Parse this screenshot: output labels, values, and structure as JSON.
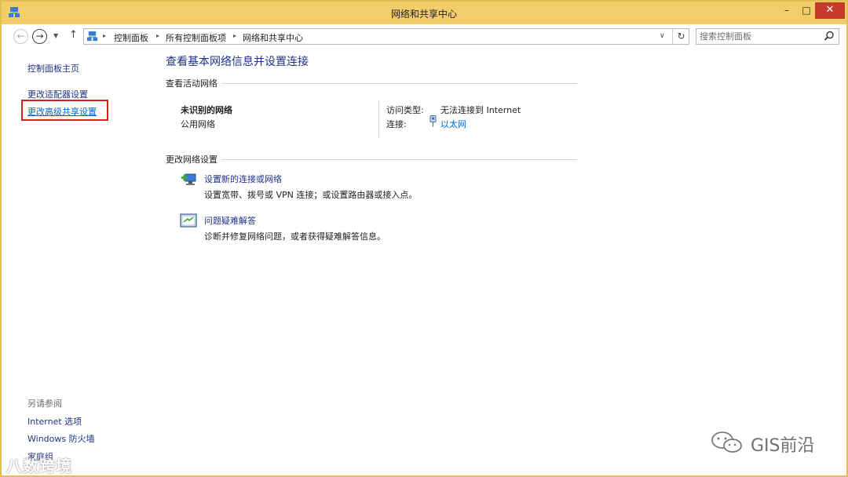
{
  "window": {
    "title": "网络和共享中心",
    "min_glyph": "–",
    "max_glyph": "□",
    "close_glyph": "✕"
  },
  "nav": {
    "back_glyph": "←",
    "forward_glyph": "→",
    "recent_glyph": "▼",
    "up_glyph": "↑"
  },
  "breadcrumb": [
    "控制面板",
    "所有控制面板项",
    "网络和共享中心"
  ],
  "address": {
    "separator_glyph": "▸",
    "dropdown_glyph": "∨",
    "refresh_glyph": "↻"
  },
  "search": {
    "placeholder": "搜索控制面板"
  },
  "sidebar": {
    "items": [
      "控制面板主页",
      "更改适配器设置",
      "更改高级共享设置"
    ],
    "see_also_title": "另请参阅",
    "see_also": [
      "Internet 选项",
      "Windows 防火墙",
      "家庭组"
    ]
  },
  "main": {
    "title": "查看基本网络信息并设置连接",
    "active_network_header": "查看活动网络",
    "network": {
      "name": "未识别的网络",
      "category": "公用网络",
      "access_label": "访问类型:",
      "access_value": "无法连接到 Internet",
      "connection_label": "连接:",
      "connection_value": "以太网"
    },
    "change_settings_header": "更改网络设置",
    "tasks": [
      {
        "title": "设置新的连接或网络",
        "desc": "设置宽带、拨号或 VPN 连接；或设置路由器或接入点。",
        "icon": "new-connection-icon"
      },
      {
        "title": "问题疑难解答",
        "desc": "诊断并修复网络问题，或者获得疑难解答信息。",
        "icon": "troubleshoot-icon"
      }
    ]
  },
  "watermarks": {
    "left": "八数跨境",
    "right": "GIS前沿"
  },
  "colors": {
    "titlebar": "#f2cd6a",
    "link": "#1e3287",
    "active_link": "#0066cc",
    "close": "#c7392b",
    "highlight_box": "#d4211c"
  }
}
